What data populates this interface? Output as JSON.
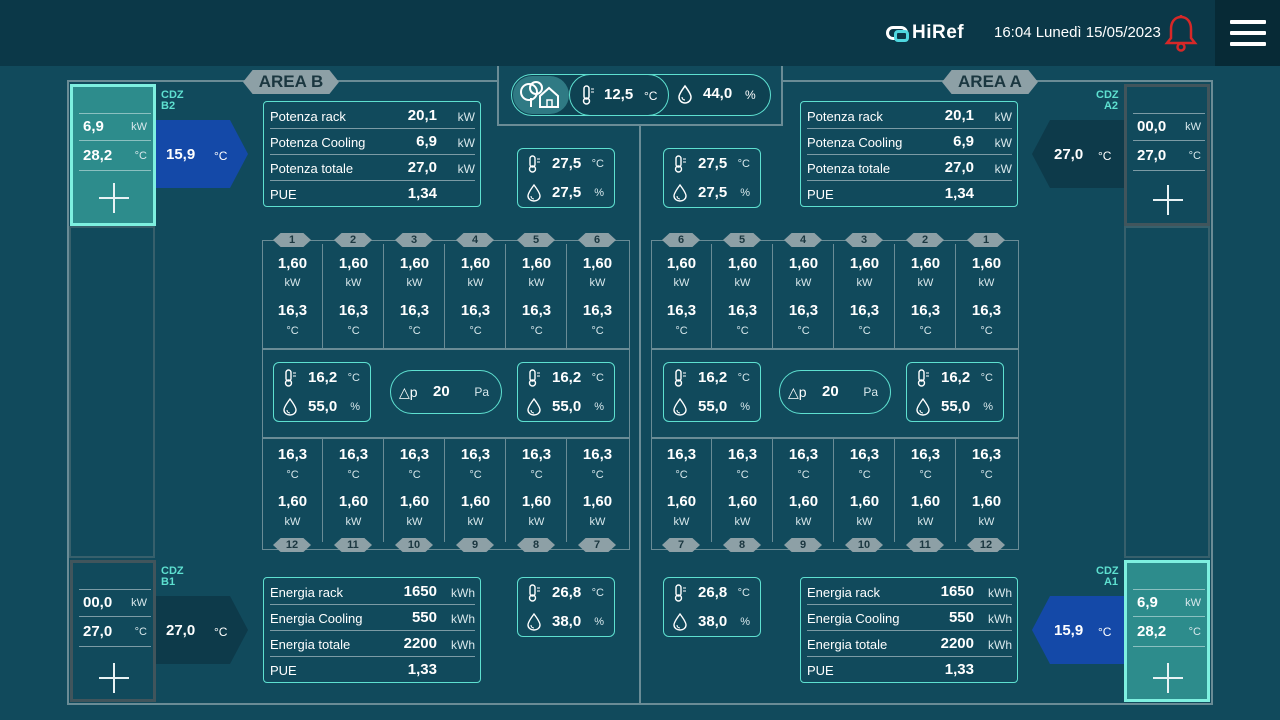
{
  "header": {
    "logo_text": "HiRef",
    "datetime": "16:04 Lunedì 15/05/2023",
    "bell_icon": "bell-icon",
    "menu_icon": "hamburger-menu-icon",
    "alarm_color": "#d62828"
  },
  "areas": {
    "b_label": "AREA B",
    "a_label": "AREA A"
  },
  "external": {
    "temp": "12,5",
    "temp_unit": "°C",
    "hum": "44,0",
    "hum_unit": "%"
  },
  "cdz": {
    "b2": {
      "label1": "CDZ",
      "label2": "B2",
      "power": "6,9",
      "power_unit": "kW",
      "temp": "28,2",
      "temp_unit": "°C",
      "arrow_val": "15,9",
      "arrow_unit": "°C"
    },
    "b1": {
      "label1": "CDZ",
      "label2": "B1",
      "power": "00,0",
      "power_unit": "kW",
      "temp": "27,0",
      "temp_unit": "°C",
      "arrow_val": "27,0",
      "arrow_unit": "°C"
    },
    "a2": {
      "label1": "CDZ",
      "label2": "A2",
      "power": "00,0",
      "power_unit": "kW",
      "temp": "27,0",
      "temp_unit": "°C",
      "arrow_val": "27,0",
      "arrow_unit": "°C"
    },
    "a1": {
      "label1": "CDZ",
      "label2": "A1",
      "power": "6,9",
      "power_unit": "kW",
      "temp": "28,2",
      "temp_unit": "°C",
      "arrow_val": "15,9",
      "arrow_unit": "°C"
    }
  },
  "power_panel": {
    "rows": [
      {
        "label": "Potenza rack",
        "value": "20,1",
        "unit": "kW"
      },
      {
        "label": "Potenza Cooling",
        "value": "6,9",
        "unit": "kW"
      },
      {
        "label": "Potenza totale",
        "value": "27,0",
        "unit": "kW"
      },
      {
        "label": "PUE",
        "value": "1,34",
        "unit": ""
      }
    ]
  },
  "energy_panel": {
    "rows": [
      {
        "label": "Energia rack",
        "value": "1650",
        "unit": "kWh"
      },
      {
        "label": "Energia Cooling",
        "value": "550",
        "unit": "kWh"
      },
      {
        "label": "Energia  totale",
        "value": "2200",
        "unit": "kWh"
      },
      {
        "label": "PUE",
        "value": "1,33",
        "unit": ""
      }
    ]
  },
  "sensors": {
    "top": {
      "temp": "27,5",
      "temp_unit": "°C",
      "hum": "27,5",
      "hum_unit": "%"
    },
    "mid": {
      "temp": "16,2",
      "temp_unit": "°C",
      "hum": "55,0",
      "hum_unit": "%"
    },
    "bottom": {
      "temp": "26,8",
      "temp_unit": "°C",
      "hum": "38,0",
      "hum_unit": "%"
    }
  },
  "dp": {
    "label": "△p",
    "value": "20",
    "unit": "Pa"
  },
  "racks": {
    "power": "1,60",
    "power_unit": "kW",
    "temp": "16,3",
    "temp_unit": "°C",
    "top_numbers_b": [
      "1",
      "2",
      "3",
      "4",
      "5",
      "6"
    ],
    "bottom_numbers_b": [
      "12",
      "11",
      "10",
      "9",
      "8",
      "7"
    ],
    "top_numbers_a": [
      "6",
      "5",
      "4",
      "3",
      "2",
      "1"
    ],
    "bottom_numbers_a": [
      "7",
      "8",
      "9",
      "10",
      "11",
      "12"
    ]
  },
  "colors": {
    "accent": "#5ee0d0",
    "active_cdz": "#2d8c8c",
    "supply_arrow": "#1449a8",
    "return_arrow": "#0d3a4a"
  }
}
